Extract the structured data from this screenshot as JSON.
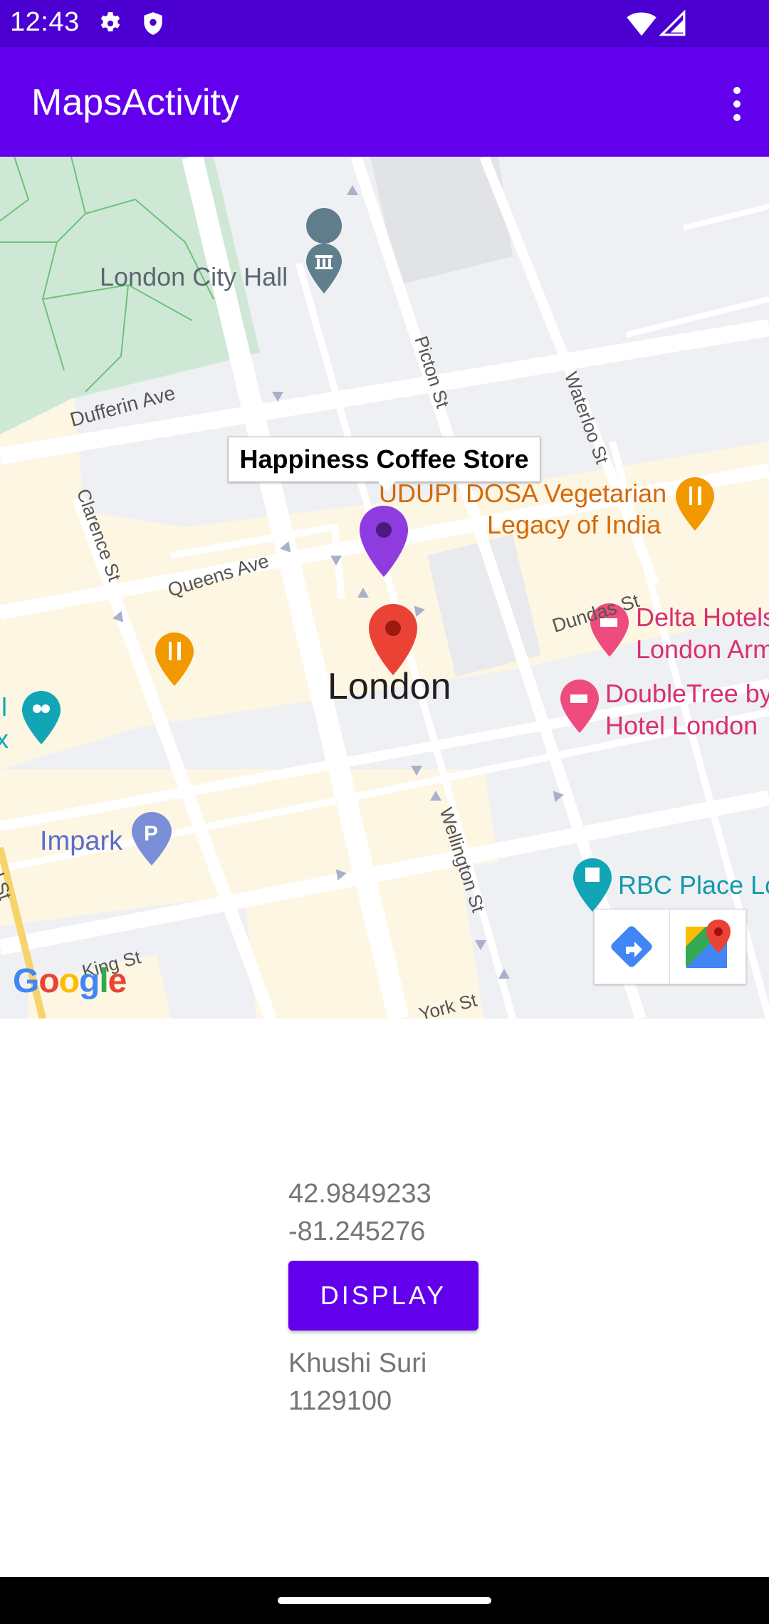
{
  "status_bar": {
    "time": "12:43",
    "icons": [
      "settings-icon",
      "shield-icon",
      "wifi-icon",
      "signal-icon"
    ]
  },
  "app_bar": {
    "title": "MapsActivity",
    "overflow_icon": "more-vert-icon"
  },
  "map": {
    "info_window_title": "Happiness Coffee Store",
    "city_label": "London",
    "places": {
      "city_hall": "London City Hall",
      "udupi_line1": "UDUPI DOSA Vegetarian",
      "udupi_line2": "Legacy of India",
      "delta_line1": "Delta Hotels",
      "delta_line2": "London Arm",
      "doubletree_line1": "DoubleTree by",
      "doubletree_line2": "Hotel London",
      "impark": "Impark",
      "rbc": "RBC Place Lo",
      "left_edge_1": "ll",
      "left_edge_2": "x"
    },
    "streets": {
      "dufferin": "Dufferin Ave",
      "picton": "Picton St",
      "waterloo": "Waterloo St",
      "clarence": "Clarence St",
      "queens": "Queens Ave",
      "dundas": "Dundas St",
      "wellington": "Wellington St",
      "king": "King St",
      "york": "York St",
      "richmond": "nd St"
    },
    "attribution": "Google",
    "toolbar": {
      "directions_icon": "directions-icon",
      "maps_icon": "google-maps-icon"
    },
    "colors": {
      "marker_purple": "#8e3ce0",
      "marker_red": "#ea4335",
      "park": "#cfe8d5",
      "commercial": "#fdf6e3"
    }
  },
  "location": {
    "latitude": "42.9849233",
    "longitude": "-81.245276"
  },
  "display_button": {
    "label": "DISPLAY"
  },
  "student": {
    "name": "Khushi Suri",
    "id": "1129100"
  },
  "theme": {
    "primary": "#6200ee",
    "primary_dark": "#4b00d1"
  }
}
